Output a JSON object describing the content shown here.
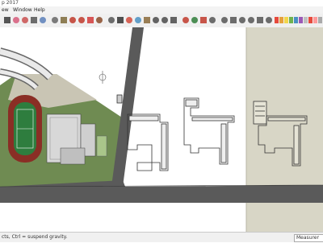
{
  "window": {
    "title": "p 2017"
  },
  "menu": {
    "items": [
      "ew",
      "Window",
      "Help"
    ]
  },
  "toolbar": {
    "buttons": [
      {
        "name": "select-icon",
        "color": "#3a3a3a"
      },
      {
        "name": "eraser-icon",
        "color": "#d65a7a"
      },
      {
        "name": "pencil-icon",
        "color": "#c9504f"
      },
      {
        "name": "line-icon",
        "color": "#555555"
      },
      {
        "name": "rectangle-icon",
        "color": "#5b7fb8"
      },
      {
        "name": "circle-icon",
        "color": "#666666"
      },
      {
        "name": "push-pull-icon",
        "color": "#7c6a3a"
      },
      {
        "name": "move-icon",
        "color": "#c0392b"
      },
      {
        "name": "rotate-icon",
        "color": "#c0392b"
      },
      {
        "name": "scale-icon",
        "color": "#d23b3b"
      },
      {
        "name": "offset-icon",
        "color": "#8a4b2a"
      },
      {
        "name": "tape-measure-icon",
        "color": "#555555"
      },
      {
        "name": "text-icon",
        "color": "#333333"
      },
      {
        "name": "paint-bucket-icon",
        "color": "#d24a3b"
      },
      {
        "name": "orbit-icon",
        "color": "#4a90c2"
      },
      {
        "name": "pan-icon",
        "color": "#8a6a3a"
      },
      {
        "name": "zoom-icon",
        "color": "#4a4a4a"
      },
      {
        "name": "zoom-window-icon",
        "color": "#4a4a4a"
      },
      {
        "name": "zoom-extents-icon",
        "color": "#4a4a4a"
      },
      {
        "name": "warehouse-icon",
        "color": "#c0392b"
      },
      {
        "name": "component-icon",
        "color": "#2f7d3a"
      },
      {
        "name": "extension-icon",
        "color": "#c0392b"
      },
      {
        "name": "iso-view-icon",
        "color": "#555555"
      },
      {
        "name": "top-view-icon",
        "color": "#555555"
      },
      {
        "name": "front-view-icon",
        "color": "#555555"
      },
      {
        "name": "right-view-icon",
        "color": "#555555"
      },
      {
        "name": "back-view-icon",
        "color": "#555555"
      },
      {
        "name": "left-view-icon",
        "color": "#555555"
      },
      {
        "name": "xray-icon",
        "color": "#555555"
      }
    ],
    "style_swatches": [
      "#e64a3c",
      "#e6a13c",
      "#f2d64b",
      "#6fb24f",
      "#4a90c2",
      "#9b59b6",
      "#c0c0c0",
      "#e64a3c",
      "#ff9a9a",
      "#aaaaaa"
    ]
  },
  "status": {
    "hint": "cts, Ctrl = suspend gravity.",
    "measurements_label": "Measurements"
  },
  "colors": {
    "road": "#5a5a5a",
    "grass": "#6f8b52",
    "track": "#8a2e25",
    "field": "#2e7d3e",
    "shaded_area": "#d8d6c6"
  }
}
